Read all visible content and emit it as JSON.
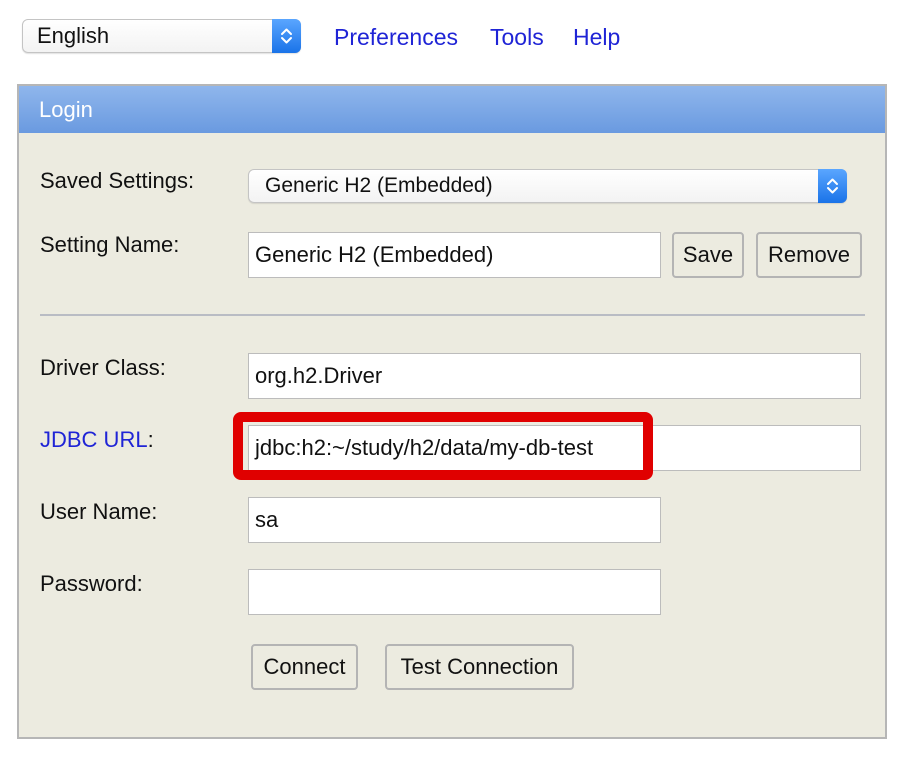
{
  "top_bar": {
    "language": "English",
    "links": [
      "Preferences",
      "Tools",
      "Help"
    ]
  },
  "login": {
    "title": "Login",
    "saved_settings": {
      "label": "Saved Settings:",
      "value": "Generic H2 (Embedded)"
    },
    "setting_name": {
      "label": "Setting Name:",
      "value": "Generic H2 (Embedded)",
      "save_label": "Save",
      "remove_label": "Remove"
    },
    "driver_class": {
      "label": "Driver Class:",
      "value": "org.h2.Driver"
    },
    "jdbc_url": {
      "label_link": "JDBC URL",
      "label_suffix": ":",
      "value": "jdbc:h2:~/study/h2/data/my-db-test"
    },
    "user_name": {
      "label": "User Name:",
      "value": "sa"
    },
    "password": {
      "label": "Password:",
      "value": ""
    },
    "buttons": {
      "connect": "Connect",
      "test_connection": "Test Connection"
    }
  },
  "colors": {
    "highlight": "#e00000",
    "link": "#1f24d6",
    "panel_bg": "#ecebe0",
    "header_bg": "#7ca7e6"
  }
}
